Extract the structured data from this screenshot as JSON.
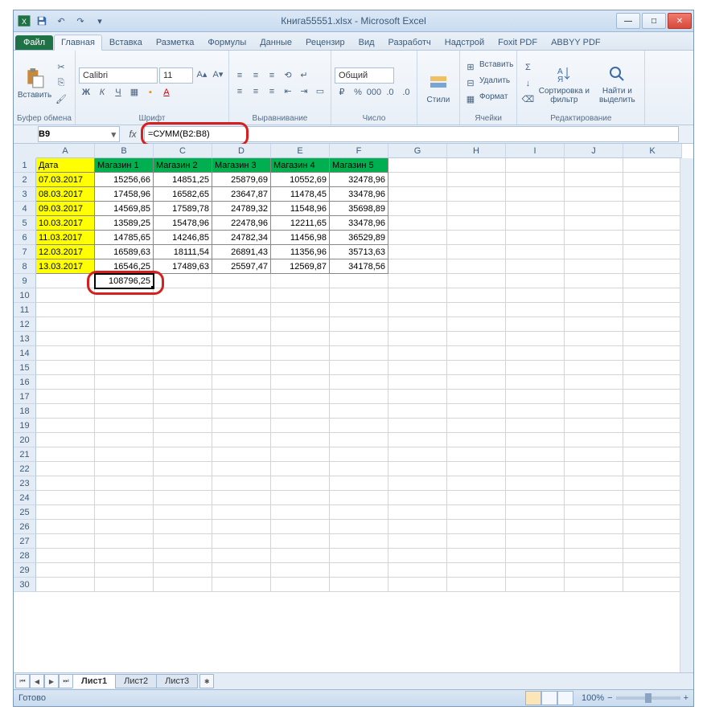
{
  "window": {
    "title": "Книга55551.xlsx - Microsoft Excel"
  },
  "tabs": {
    "file": "Файл",
    "list": [
      "Главная",
      "Вставка",
      "Разметка",
      "Формулы",
      "Данные",
      "Рецензир",
      "Вид",
      "Разработч",
      "Надстрой",
      "Foxit PDF",
      "ABBYY PDF"
    ],
    "active_index": 0
  },
  "ribbon": {
    "clipboard": {
      "paste": "Вставить",
      "label": "Буфер обмена"
    },
    "font": {
      "name": "Calibri",
      "size": "11",
      "label": "Шрифт",
      "bold": "Ж",
      "italic": "К",
      "underline": "Ч"
    },
    "alignment": {
      "label": "Выравнивание"
    },
    "number": {
      "format": "Общий",
      "label": "Число"
    },
    "styles": {
      "btn": "Стили",
      "label": ""
    },
    "cells": {
      "insert": "Вставить",
      "delete": "Удалить",
      "format": "Формат",
      "label": "Ячейки"
    },
    "editing": {
      "sort": "Сортировка и фильтр",
      "find": "Найти и выделить",
      "label": "Редактирование"
    }
  },
  "namebox": "B9",
  "formula": "=СУММ(B2:B8)",
  "columns": [
    "A",
    "B",
    "C",
    "D",
    "E",
    "F",
    "G",
    "H",
    "I",
    "J",
    "K"
  ],
  "headers": [
    "Дата",
    "Магазин 1",
    "Магазин 2",
    "Магазин 3",
    "Магазин 4",
    "Магазин 5"
  ],
  "rows": [
    {
      "date": "07.03.2017",
      "v": [
        "15256,66",
        "14851,25",
        "25879,69",
        "10552,69",
        "32478,96"
      ]
    },
    {
      "date": "08.03.2017",
      "v": [
        "17458,96",
        "16582,65",
        "23647,87",
        "11478,45",
        "33478,96"
      ]
    },
    {
      "date": "09.03.2017",
      "v": [
        "14569,85",
        "17589,78",
        "24789,32",
        "11548,96",
        "35698,89"
      ]
    },
    {
      "date": "10.03.2017",
      "v": [
        "13589,25",
        "15478,96",
        "22478,96",
        "12211,65",
        "33478,96"
      ]
    },
    {
      "date": "11.03.2017",
      "v": [
        "14785,65",
        "14246,85",
        "24782,34",
        "11456,98",
        "36529,89"
      ]
    },
    {
      "date": "12.03.2017",
      "v": [
        "16589,63",
        "18111,54",
        "26891,43",
        "11356,96",
        "35713,63"
      ]
    },
    {
      "date": "13.03.2017",
      "v": [
        "16546,25",
        "17489,63",
        "25597,47",
        "12569,87",
        "34178,56"
      ]
    }
  ],
  "result": {
    "cell": "B9",
    "value": "108796,25"
  },
  "sheets": {
    "list": [
      "Лист1",
      "Лист2",
      "Лист3"
    ],
    "active": 0
  },
  "status": {
    "ready": "Готово",
    "zoom": "100%"
  }
}
